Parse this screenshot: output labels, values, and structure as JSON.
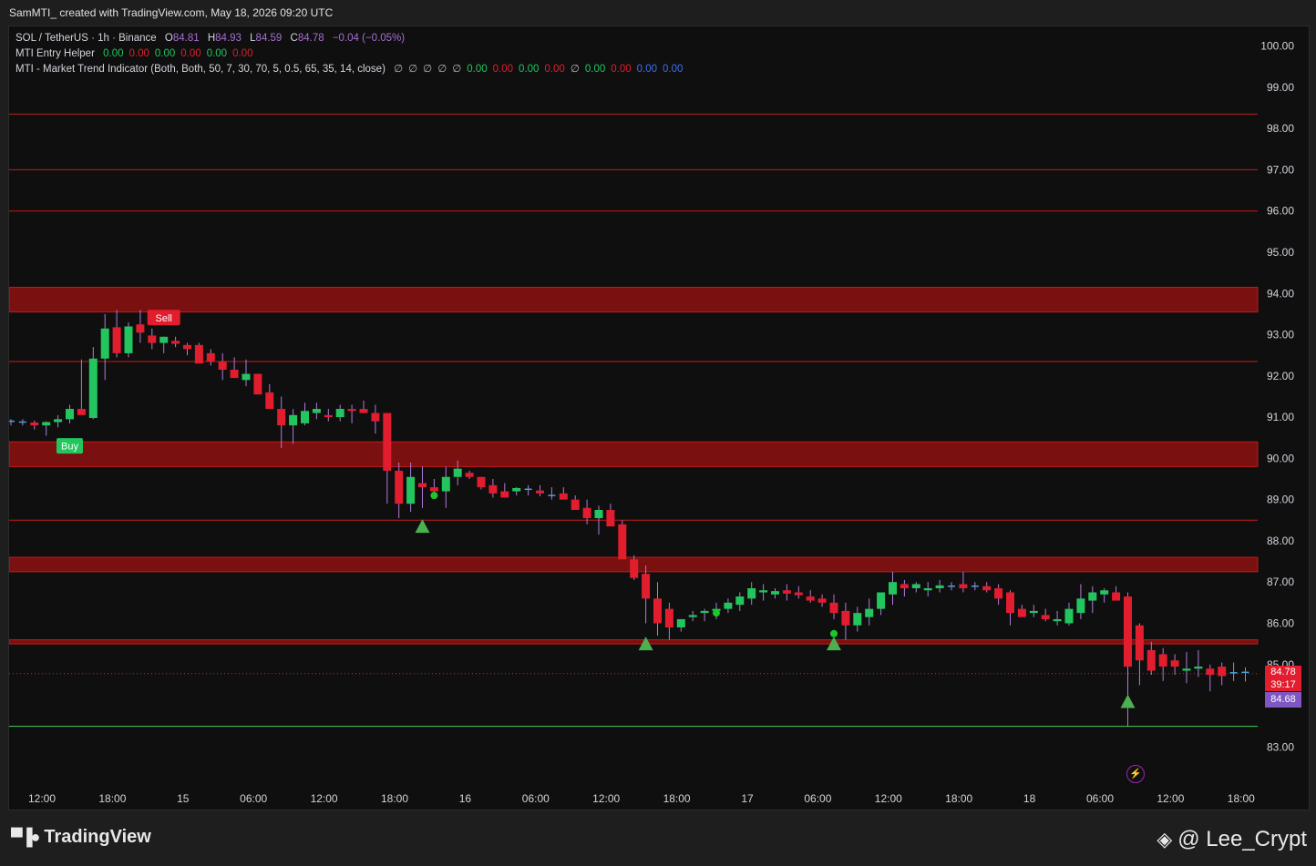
{
  "header": {
    "text": "SamMTI_ created with TradingView.com, May 18, 2026 09:20 UTC"
  },
  "legend": {
    "symbol": "SOL / TetherUS · 1h · Binance",
    "open_key": "O",
    "open": "84.81",
    "high_key": "H",
    "high": "84.93",
    "low_key": "L",
    "low": "84.59",
    "close_key": "C",
    "close": "84.78",
    "change": "−0.04 (−0.05%)",
    "entry_helper": {
      "label": "MTI Entry Helper",
      "values": [
        {
          "v": "0.00",
          "c": "green"
        },
        {
          "v": "0.00",
          "c": "red"
        },
        {
          "v": "0.00",
          "c": "green"
        },
        {
          "v": "0.00",
          "c": "red"
        },
        {
          "v": "0.00",
          "c": "green"
        },
        {
          "v": "0.00",
          "c": "red"
        }
      ]
    },
    "market_trend": {
      "label": "MTI - Market Trend Indicator (Both, Both, 50, 7, 30, 70, 5, 0.5, 65, 35, 14, close)",
      "values": [
        {
          "v": "∅",
          "c": "null"
        },
        {
          "v": "∅",
          "c": "null"
        },
        {
          "v": "∅",
          "c": "null"
        },
        {
          "v": "∅",
          "c": "null"
        },
        {
          "v": "∅",
          "c": "null"
        },
        {
          "v": "0.00",
          "c": "green"
        },
        {
          "v": "0.00",
          "c": "red"
        },
        {
          "v": "0.00",
          "c": "green"
        },
        {
          "v": "0.00",
          "c": "red"
        },
        {
          "v": "∅",
          "c": "null"
        },
        {
          "v": "0.00",
          "c": "green"
        },
        {
          "v": "0.00",
          "c": "red"
        },
        {
          "v": "0.00",
          "c": "blue"
        },
        {
          "v": "0.00",
          "c": "blue"
        }
      ]
    }
  },
  "price_tags": {
    "last_price": "84.78",
    "countdown": "39:17",
    "other_price": "84.68"
  },
  "footer": {
    "logo_text": "TradingView",
    "watermark": "@ Lee_Crypt"
  },
  "icons": {
    "flash": "lightning-icon",
    "brand": "tradingview-logo-icon",
    "binance": "binance-diamond-icon"
  },
  "colors": {
    "up": "#22c55e",
    "down": "#e11d2e",
    "zone": "#7a1010",
    "line": "#c41a1a",
    "support": "#3ecf5a",
    "triangle": "#4caf50"
  },
  "chart_data": {
    "type": "candlestick",
    "timeframe": "1h",
    "y_axis": {
      "ticks": [
        "100.00",
        "99.00",
        "98.00",
        "97.00",
        "96.00",
        "95.00",
        "94.00",
        "93.00",
        "92.00",
        "91.00",
        "90.00",
        "89.00",
        "88.00",
        "87.00",
        "86.00",
        "85.00",
        "83.00"
      ],
      "range": [
        82.3,
        100.3
      ]
    },
    "x_axis": {
      "labels": [
        "12:00",
        "18:00",
        "15",
        "06:00",
        "12:00",
        "18:00",
        "16",
        "06:00",
        "12:00",
        "18:00",
        "17",
        "06:00",
        "12:00",
        "18:00",
        "18",
        "06:00",
        "12:00",
        "18:00"
      ],
      "label_index": [
        0,
        6,
        12,
        18,
        24,
        30,
        36,
        42,
        48,
        54,
        60,
        66,
        72,
        78,
        84,
        90,
        96,
        102
      ]
    },
    "candles": [
      [
        90.9,
        90.95,
        90.8,
        90.88
      ],
      [
        90.88,
        90.95,
        90.8,
        90.87
      ],
      [
        90.87,
        90.92,
        90.7,
        90.8
      ],
      [
        90.8,
        90.9,
        90.55,
        90.88
      ],
      [
        90.88,
        91.05,
        90.75,
        90.95
      ],
      [
        90.95,
        91.3,
        90.85,
        91.2
      ],
      [
        91.2,
        92.4,
        91.05,
        91.05
      ],
      [
        90.98,
        92.7,
        90.95,
        92.42
      ],
      [
        92.42,
        93.5,
        91.9,
        93.15
      ],
      [
        93.18,
        93.6,
        92.45,
        92.55
      ],
      [
        92.55,
        93.3,
        92.45,
        93.2
      ],
      [
        93.25,
        93.6,
        92.8,
        93.05
      ],
      [
        92.98,
        93.15,
        92.65,
        92.8
      ],
      [
        92.8,
        92.95,
        92.55,
        92.95
      ],
      [
        92.85,
        92.95,
        92.7,
        92.78
      ],
      [
        92.75,
        92.8,
        92.5,
        92.65
      ],
      [
        92.75,
        92.8,
        92.35,
        92.3
      ],
      [
        92.55,
        92.65,
        92.25,
        92.35
      ],
      [
        92.35,
        92.55,
        91.9,
        92.15
      ],
      [
        92.15,
        92.45,
        92.0,
        91.95
      ],
      [
        91.9,
        92.4,
        91.75,
        92.05
      ],
      [
        92.05,
        92.05,
        91.55,
        91.55
      ],
      [
        91.6,
        91.8,
        91.25,
        91.2
      ],
      [
        91.2,
        91.5,
        90.25,
        90.8
      ],
      [
        90.8,
        91.2,
        90.35,
        91.05
      ],
      [
        90.85,
        91.35,
        90.8,
        91.15
      ],
      [
        91.1,
        91.35,
        90.95,
        91.2
      ],
      [
        91.05,
        91.2,
        90.9,
        91.0
      ],
      [
        91.0,
        91.3,
        90.9,
        91.2
      ],
      [
        91.2,
        91.3,
        90.85,
        91.15
      ],
      [
        91.2,
        91.4,
        91.1,
        91.1
      ],
      [
        91.1,
        91.3,
        90.6,
        90.9
      ],
      [
        91.1,
        91.1,
        88.9,
        89.7
      ],
      [
        89.7,
        89.9,
        88.55,
        88.9
      ],
      [
        88.9,
        89.9,
        88.7,
        89.55
      ],
      [
        89.4,
        89.8,
        88.8,
        89.3
      ],
      [
        89.3,
        89.5,
        89.15,
        89.2
      ],
      [
        89.2,
        89.8,
        88.8,
        89.55
      ],
      [
        89.55,
        89.95,
        89.35,
        89.75
      ],
      [
        89.65,
        89.7,
        89.5,
        89.55
      ],
      [
        89.55,
        89.55,
        89.25,
        89.3
      ],
      [
        89.35,
        89.5,
        89.05,
        89.15
      ],
      [
        89.2,
        89.4,
        89.05,
        89.05
      ],
      [
        89.2,
        89.3,
        89.1,
        89.28
      ],
      [
        89.25,
        89.35,
        89.1,
        89.25
      ],
      [
        89.22,
        89.35,
        89.08,
        89.15
      ],
      [
        89.1,
        89.3,
        89.0,
        89.08
      ],
      [
        89.15,
        89.3,
        89.05,
        89.0
      ],
      [
        89.0,
        89.1,
        88.85,
        88.75
      ],
      [
        88.8,
        89.0,
        88.4,
        88.55
      ],
      [
        88.55,
        88.85,
        88.15,
        88.75
      ],
      [
        88.75,
        88.9,
        88.4,
        88.35
      ],
      [
        88.4,
        88.5,
        87.6,
        87.55
      ],
      [
        87.55,
        87.65,
        87.05,
        87.1
      ],
      [
        87.2,
        87.4,
        86.0,
        86.6
      ],
      [
        86.6,
        87.0,
        85.7,
        86.0
      ],
      [
        86.35,
        86.5,
        85.6,
        85.9
      ],
      [
        85.9,
        86.1,
        85.8,
        86.1
      ],
      [
        86.15,
        86.3,
        86.05,
        86.2
      ],
      [
        86.25,
        86.35,
        86.05,
        86.3
      ],
      [
        86.3,
        86.5,
        86.1,
        86.35
      ],
      [
        86.35,
        86.6,
        86.25,
        86.5
      ],
      [
        86.45,
        86.75,
        86.3,
        86.65
      ],
      [
        86.6,
        87.0,
        86.45,
        86.85
      ],
      [
        86.75,
        86.95,
        86.55,
        86.8
      ],
      [
        86.7,
        86.85,
        86.6,
        86.78
      ],
      [
        86.8,
        86.95,
        86.55,
        86.72
      ],
      [
        86.75,
        86.9,
        86.6,
        86.68
      ],
      [
        86.65,
        86.8,
        86.5,
        86.55
      ],
      [
        86.6,
        86.7,
        86.4,
        86.5
      ],
      [
        86.5,
        86.7,
        86.1,
        86.25
      ],
      [
        86.3,
        86.5,
        85.6,
        85.95
      ],
      [
        85.95,
        86.4,
        85.8,
        86.25
      ],
      [
        86.15,
        86.6,
        85.95,
        86.35
      ],
      [
        86.35,
        86.75,
        86.2,
        86.75
      ],
      [
        86.7,
        87.25,
        86.45,
        87.0
      ],
      [
        86.95,
        87.05,
        86.65,
        86.85
      ],
      [
        86.85,
        87.0,
        86.75,
        86.95
      ],
      [
        86.8,
        87.0,
        86.65,
        86.85
      ],
      [
        86.85,
        87.05,
        86.75,
        86.92
      ],
      [
        86.9,
        87.0,
        86.8,
        86.9
      ],
      [
        86.95,
        87.25,
        86.75,
        86.85
      ],
      [
        86.9,
        87.0,
        86.8,
        86.9
      ],
      [
        86.9,
        87.0,
        86.75,
        86.8
      ],
      [
        86.85,
        86.95,
        86.45,
        86.6
      ],
      [
        86.75,
        86.8,
        85.95,
        86.25
      ],
      [
        86.35,
        86.45,
        86.2,
        86.15
      ],
      [
        86.25,
        86.45,
        86.15,
        86.3
      ],
      [
        86.2,
        86.35,
        86.05,
        86.1
      ],
      [
        86.05,
        86.3,
        85.95,
        86.1
      ],
      [
        86.0,
        86.5,
        85.95,
        86.35
      ],
      [
        86.25,
        86.95,
        86.1,
        86.6
      ],
      [
        86.55,
        86.9,
        86.25,
        86.75
      ],
      [
        86.7,
        86.85,
        86.5,
        86.8
      ],
      [
        86.75,
        86.9,
        86.6,
        86.55
      ],
      [
        86.65,
        86.75,
        83.5,
        84.95
      ],
      [
        85.95,
        86.0,
        84.5,
        85.1
      ],
      [
        85.35,
        85.55,
        84.75,
        84.85
      ],
      [
        85.25,
        85.4,
        84.6,
        84.95
      ],
      [
        85.1,
        85.25,
        84.75,
        84.95
      ],
      [
        84.85,
        85.3,
        84.55,
        84.9
      ],
      [
        84.9,
        85.35,
        84.7,
        84.95
      ],
      [
        84.9,
        85.0,
        84.35,
        84.75
      ],
      [
        84.95,
        85.05,
        84.5,
        84.72
      ],
      [
        84.8,
        85.05,
        84.6,
        84.78
      ],
      [
        84.81,
        84.93,
        84.59,
        84.78
      ]
    ],
    "zones": [
      [
        93.55,
        94.15
      ],
      [
        89.8,
        90.4
      ],
      [
        87.25,
        87.6
      ],
      [
        85.5,
        85.6
      ]
    ],
    "resistance_lines": [
      98.35,
      97.0,
      96.0,
      92.35,
      88.5
    ],
    "support_line": 83.5,
    "signals": [
      {
        "i": 5,
        "type": "label",
        "text": "Buy",
        "price": 90.8,
        "color": "#22c55e"
      },
      {
        "i": 13,
        "type": "label",
        "text": "Sell",
        "price": 93.05,
        "color": "#e11d2e"
      },
      {
        "i": 35,
        "type": "triangle",
        "price": 88.35
      },
      {
        "i": 54,
        "type": "triangle",
        "price": 85.5
      },
      {
        "i": 70,
        "type": "triangle",
        "price": 85.5
      },
      {
        "i": 95,
        "type": "triangle",
        "price": 84.1
      },
      {
        "i": 36,
        "type": "dot",
        "price": 89.1
      },
      {
        "i": 60,
        "type": "dot",
        "price": 86.25
      },
      {
        "i": 70,
        "type": "dot",
        "price": 85.75
      }
    ],
    "last_price_line": 84.78
  }
}
